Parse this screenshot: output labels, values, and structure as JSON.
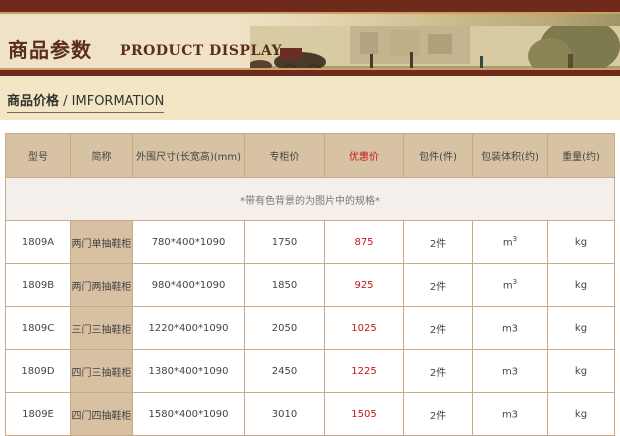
{
  "banner": {
    "title_cn": "商品参数",
    "title_en": "PRODUCT DISPLAY"
  },
  "section": {
    "title_cn": "商品价格",
    "title_sep": " / ",
    "title_en": "IMFORMATION"
  },
  "table": {
    "headers": [
      "型号",
      "简称",
      "外围尺寸(长宽高)(mm)",
      "专柜价",
      "优惠价",
      "包件(件)",
      "包装体积(约)",
      "重量(约)"
    ],
    "note": "*带有色背景的为图片中的规格*",
    "rows": [
      {
        "model": "1809A",
        "name": "两门单抽鞋柜",
        "size": "780*400*1090",
        "list_price": "1750",
        "sale_price": "875",
        "packages": "2件",
        "volume": "m",
        "volume_sup": "3",
        "weight": "kg"
      },
      {
        "model": "1809B",
        "name": "两门两抽鞋柜",
        "size": "980*400*1090",
        "list_price": "1850",
        "sale_price": "925",
        "packages": "2件",
        "volume": "m",
        "volume_sup": "3",
        "weight": "kg"
      },
      {
        "model": "1809C",
        "name": "三门三抽鞋柜",
        "size": "1220*400*1090",
        "list_price": "2050",
        "sale_price": "1025",
        "packages": "2件",
        "volume": "m3",
        "volume_sup": "",
        "weight": "kg"
      },
      {
        "model": "1809D",
        "name": "四门三抽鞋柜",
        "size": "1380*400*1090",
        "list_price": "2450",
        "sale_price": "1225",
        "packages": "2件",
        "volume": "m3",
        "volume_sup": "",
        "weight": "kg"
      },
      {
        "model": "1809E",
        "name": "四门四抽鞋柜",
        "size": "1580*400*1090",
        "list_price": "3010",
        "sale_price": "1505",
        "packages": "2件",
        "volume": "m3",
        "volume_sup": "",
        "weight": "kg"
      }
    ]
  },
  "colors": {
    "banner_frame": "#6e2a1b",
    "section_bg": "#f3e6c4",
    "header_bg": "#d7c2a3",
    "highlight_cell": "#d8c0a3",
    "sale_price": "#c4161c"
  }
}
